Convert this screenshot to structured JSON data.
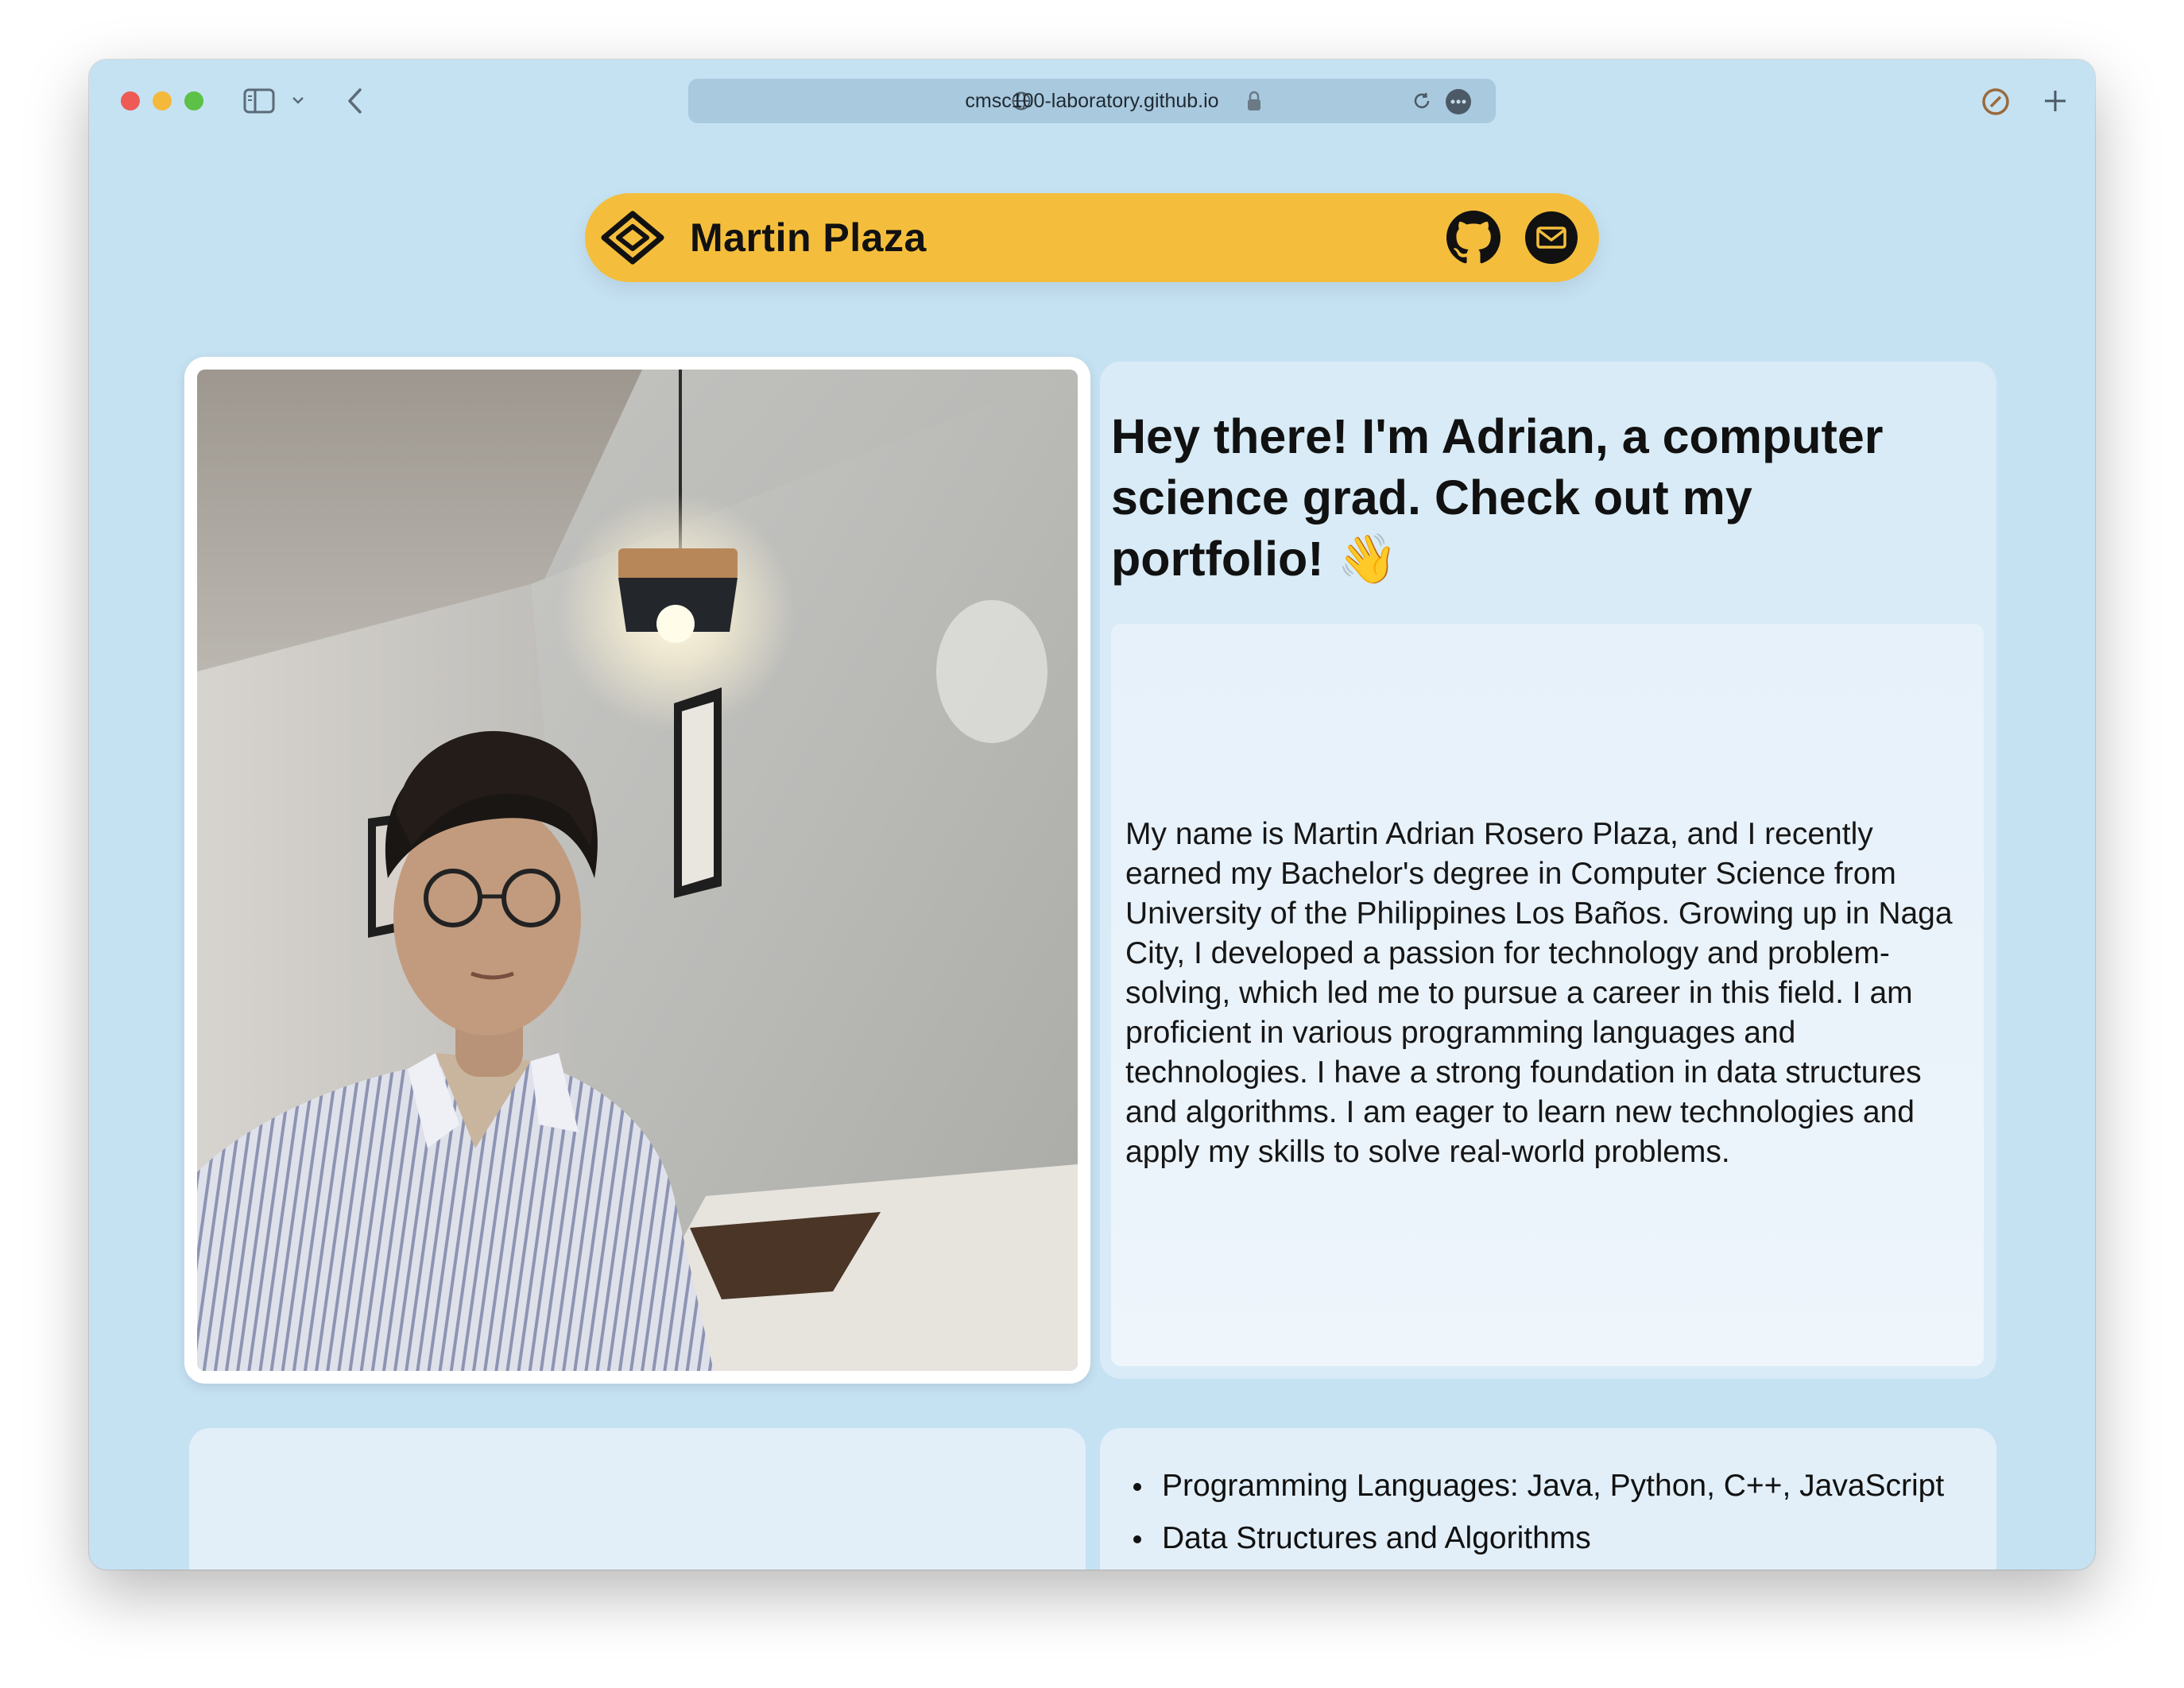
{
  "browser": {
    "url": "cmsc100-laboratory.github.io"
  },
  "navbar": {
    "brand_name": "Martin Plaza",
    "logo_icon": "diamond-logo-icon",
    "github_icon": "github-icon",
    "email_icon": "mail-icon",
    "accent_color": "#f4be3c"
  },
  "intro": {
    "heading": "Hey there! I'm Adrian, a computer science grad. Check out my portfolio! 👋",
    "bio": "My name is Martin Adrian Rosero Plaza, and I recently earned my Bachelor's degree in Computer Science from University of the Philippines Los Baños. Growing up in Naga City, I developed a passion for technology and problem-solving, which led me to pursue a career in this field. I am proficient in various programming languages and technologies. I have a strong foundation in data structures and algorithms. I am eager to learn new technologies and apply my skills to solve real-world problems."
  },
  "skills": {
    "items": [
      "Programming Languages: Java, Python, C++, JavaScript",
      "Data Structures and Algorithms"
    ]
  }
}
